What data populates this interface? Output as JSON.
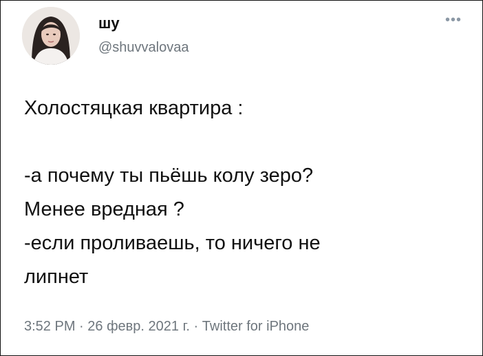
{
  "tweet": {
    "author": {
      "display_name": "шу",
      "handle": "@shuvvalovaa",
      "avatar_icon": "profile-photo"
    },
    "more_label": "•••",
    "text_lines": [
      "Холостяцкая квартира :",
      "",
      "-а почему ты пьёшь колу зеро?",
      "Менее вредная ?",
      "-если проливаешь, то ничего не",
      "липнет"
    ],
    "meta": {
      "time": "3:52 PM",
      "separator": "·",
      "date": "26 февр. 2021 г.",
      "source": "Twitter for iPhone"
    }
  }
}
